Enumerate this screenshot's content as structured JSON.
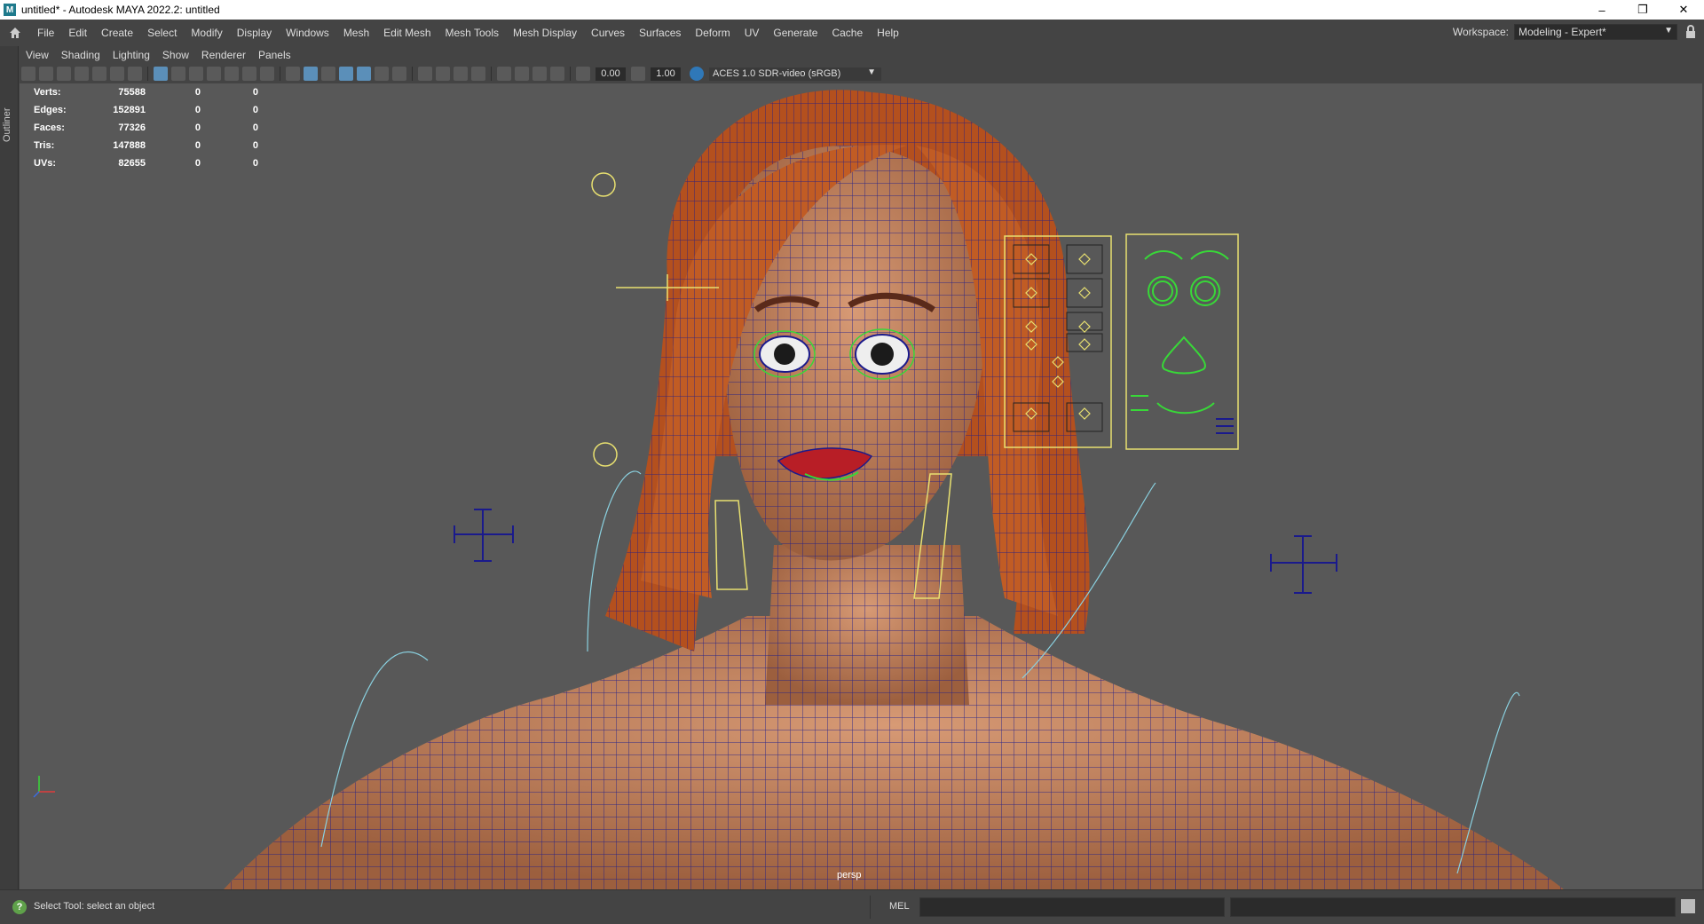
{
  "window": {
    "title": "untitled* - Autodesk MAYA 2022.2: untitled",
    "logo_letter": "M",
    "controls": [
      "–",
      "❐",
      "✕"
    ]
  },
  "menubar": {
    "items": [
      "File",
      "Edit",
      "Create",
      "Select",
      "Modify",
      "Display",
      "Windows",
      "Mesh",
      "Edit Mesh",
      "Mesh Tools",
      "Mesh Display",
      "Curves",
      "Surfaces",
      "Deform",
      "UV",
      "Generate",
      "Cache",
      "Help"
    ]
  },
  "workspace": {
    "label": "Workspace:",
    "value": "Modeling - Expert*"
  },
  "outliner": {
    "label": "Outliner"
  },
  "panel_menu": {
    "items": [
      "View",
      "Shading",
      "Lighting",
      "Show",
      "Renderer",
      "Panels"
    ]
  },
  "view_toolbar": {
    "field1": "0.00",
    "field2": "1.00",
    "color_space": "ACES 1.0 SDR-video (sRGB)"
  },
  "hud": {
    "rows": [
      {
        "label": "Verts:",
        "v1": "75588",
        "v2": "0",
        "v3": "0"
      },
      {
        "label": "Edges:",
        "v1": "152891",
        "v2": "0",
        "v3": "0"
      },
      {
        "label": "Faces:",
        "v1": "77326",
        "v2": "0",
        "v3": "0"
      },
      {
        "label": "Tris:",
        "v1": "147888",
        "v2": "0",
        "v3": "0"
      },
      {
        "label": "UVs:",
        "v1": "82655",
        "v2": "0",
        "v3": "0"
      }
    ]
  },
  "viewport": {
    "camera": "persp",
    "colors": {
      "background": "#585858",
      "skin": "#b87955",
      "hair": "#b4501e",
      "wire": "#1a1a8c",
      "control_yellow": "#e8e070",
      "control_green": "#38d838"
    }
  },
  "statusbar": {
    "help_text": "Select Tool: select an object",
    "mel_label": "MEL"
  }
}
